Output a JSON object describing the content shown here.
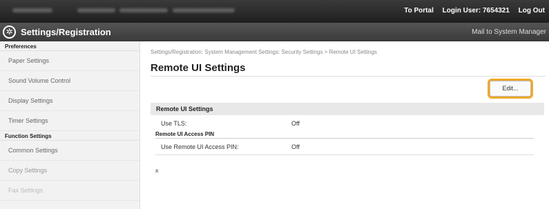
{
  "topbar": {
    "portal_link": "To Portal",
    "login_user": "Login User: 7654321",
    "logout": "Log Out"
  },
  "header": {
    "title": "Settings/Registration",
    "mail_link": "Mail to System Manager"
  },
  "sidebar": {
    "sections": [
      {
        "label": "Preferences",
        "items": [
          "Paper Settings",
          "Sound Volume Control",
          "Display Settings",
          "Timer Settings"
        ]
      },
      {
        "label": "Function Settings",
        "items": [
          "Common Settings",
          "Copy Settings",
          "Fax Settings"
        ]
      }
    ]
  },
  "main": {
    "breadcrumb": "Settings/Registration: System Management Settings: Security Settings > Remote UI Settings",
    "page_title": "Remote UI Settings",
    "edit_label": "Edit...",
    "section_title": "Remote UI Settings",
    "rows": [
      {
        "label": "Use TLS:",
        "value": "Off"
      }
    ],
    "subsection_title": "Remote UI Access PIN",
    "sub_rows": [
      {
        "label": "Use Remote UI Access PIN:",
        "value": "Off"
      }
    ],
    "top_arrow": "⌅"
  },
  "colors": {
    "highlight": "#f0a92a",
    "topbar": "#2a2a2a",
    "header": "#474747"
  }
}
